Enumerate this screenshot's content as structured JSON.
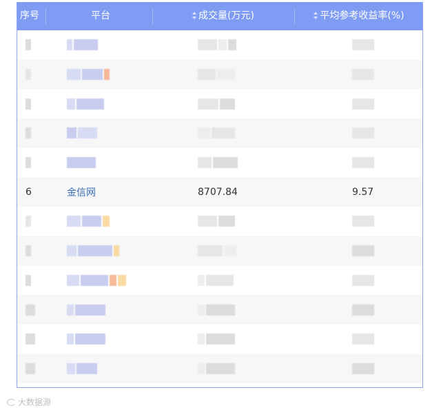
{
  "table": {
    "headers": {
      "index": "序号",
      "platform": "平台",
      "volume": "成交量(万元)",
      "rate": "平均参考收益率(%)"
    },
    "visible_row": {
      "index": "6",
      "platform": "金信网",
      "volume": "8707.84",
      "rate": "9.57"
    }
  },
  "watermark": {
    "text": "大数据源"
  },
  "colors": {
    "header_bg": "#7f9cf5",
    "link": "#3a6db5",
    "row_alt": "#f7f7f8"
  }
}
